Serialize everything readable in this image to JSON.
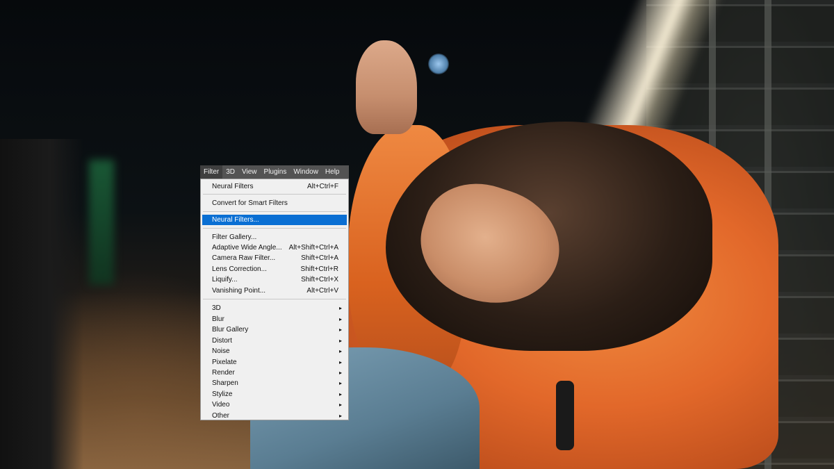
{
  "menubar": {
    "items": [
      {
        "label": "Filter",
        "active": true
      },
      {
        "label": "3D"
      },
      {
        "label": "View"
      },
      {
        "label": "Plugins"
      },
      {
        "label": "Window"
      },
      {
        "label": "Help"
      }
    ]
  },
  "filter_menu": {
    "last_filter": {
      "label": "Neural Filters",
      "shortcut": "Alt+Ctrl+F"
    },
    "convert_smart": {
      "label": "Convert for Smart Filters"
    },
    "neural": {
      "label": "Neural Filters..."
    },
    "gallery_group": [
      {
        "label": "Filter Gallery...",
        "shortcut": ""
      },
      {
        "label": "Adaptive Wide Angle...",
        "shortcut": "Alt+Shift+Ctrl+A"
      },
      {
        "label": "Camera Raw Filter...",
        "shortcut": "Shift+Ctrl+A"
      },
      {
        "label": "Lens Correction...",
        "shortcut": "Shift+Ctrl+R"
      },
      {
        "label": "Liquify...",
        "shortcut": "Shift+Ctrl+X"
      },
      {
        "label": "Vanishing Point...",
        "shortcut": "Alt+Ctrl+V"
      }
    ],
    "submenus": [
      {
        "label": "3D",
        "arrow": "▸"
      },
      {
        "label": "Blur",
        "arrow": "▸"
      },
      {
        "label": "Blur Gallery",
        "arrow": "▸"
      },
      {
        "label": "Distort",
        "arrow": "▸"
      },
      {
        "label": "Noise",
        "arrow": "▸"
      },
      {
        "label": "Pixelate",
        "arrow": "▸"
      },
      {
        "label": "Render",
        "arrow": "▸"
      },
      {
        "label": "Sharpen",
        "arrow": "▸"
      },
      {
        "label": "Stylize",
        "arrow": "▸"
      },
      {
        "label": "Video",
        "arrow": "▸"
      },
      {
        "label": "Other",
        "arrow": "▸"
      }
    ]
  },
  "colors": {
    "highlight": "#0a6fd3",
    "menubar": "#535353",
    "menu_bg": "#f0f0f0"
  }
}
